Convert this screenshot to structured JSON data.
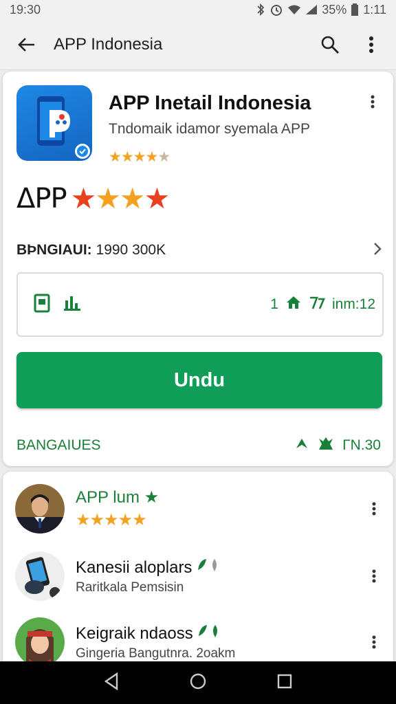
{
  "status_bar": {
    "time": "19:30",
    "battery": "35%",
    "clock_right": "1:11"
  },
  "app_bar": {
    "title": "APP Indonesia"
  },
  "app_card": {
    "name": "APP Inetail Indonesia",
    "subtitle": "Tndomaik idamor syemala APP",
    "small_stars": "★★★★★",
    "rating_label": "ΔPP",
    "big_stars": "★★★★",
    "info_label": "BÞNGIAUI:",
    "info_value": "1990 300K",
    "stats_right": "1",
    "stats_right_text": "inm:12",
    "install_label": "Undu",
    "footer_left": "BANGAIUES",
    "footer_right": "ΓN.30"
  },
  "reviews": [
    {
      "name": "APP lum",
      "sub": "★★★★★",
      "badge": "★"
    },
    {
      "name": "Kanesii aloplars",
      "sub": "Raritkala Pemsisin"
    },
    {
      "name": "Keigraik ndaoss",
      "sub": "Gingeria Bangutnra. 2oakm"
    }
  ],
  "colors": {
    "accent_green": "#0f9d58",
    "star_orange": "#f4a020",
    "star_red": "#e8411f"
  },
  "icons": [
    "back-arrow-icon",
    "search-icon",
    "more-vert-icon",
    "bluetooth-icon",
    "alarm-icon",
    "wifi-icon",
    "signal-icon",
    "battery-icon",
    "home-icon",
    "back-nav-icon",
    "recents-icon"
  ]
}
